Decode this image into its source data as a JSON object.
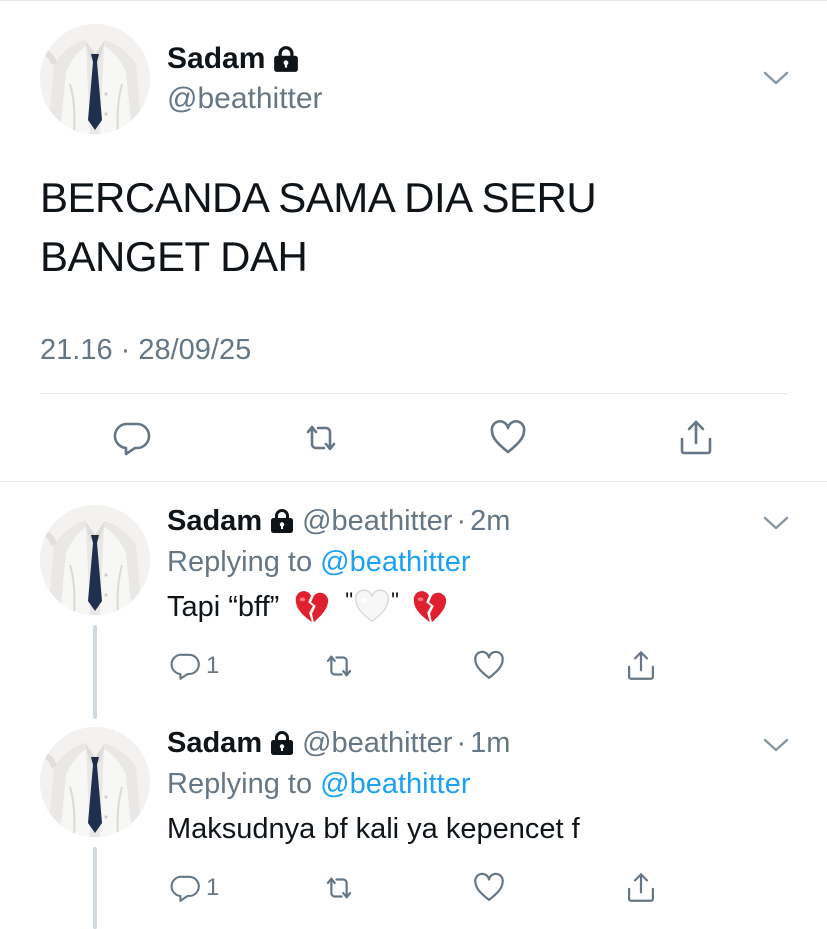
{
  "main_tweet": {
    "name": "Sadam",
    "handle": "@beathitter",
    "text_line1": "BERCANDA SAMA DIA SERU",
    "text_line2": "BANGET DAH",
    "timestamp": "21.16 · 28/09/25"
  },
  "replies": [
    {
      "name": "Sadam",
      "handle": "@beathitter",
      "dot": "·",
      "time": "2m",
      "replying_prefix": "Replying to",
      "replying_mention": "@beathitter",
      "text": "Tapi “bff”",
      "reply_count": "1"
    },
    {
      "name": "Sadam",
      "handle": "@beathitter",
      "dot": "·",
      "time": "1m",
      "replying_prefix": "Replying to",
      "replying_mention": "@beathitter",
      "text": "Maksudnya bf kali ya kepencet f",
      "reply_count": "1"
    }
  ],
  "colors": {
    "text": "#0f1419",
    "secondary": "#657786",
    "accent": "#1da1f2",
    "divider": "#e1e8ed",
    "thread": "#cfd9de"
  },
  "icons": [
    "lock-icon",
    "chevron-down-icon",
    "reply-icon",
    "retweet-icon",
    "like-icon",
    "share-icon",
    "broken-heart-emoji",
    "white-heart-emoji"
  ]
}
